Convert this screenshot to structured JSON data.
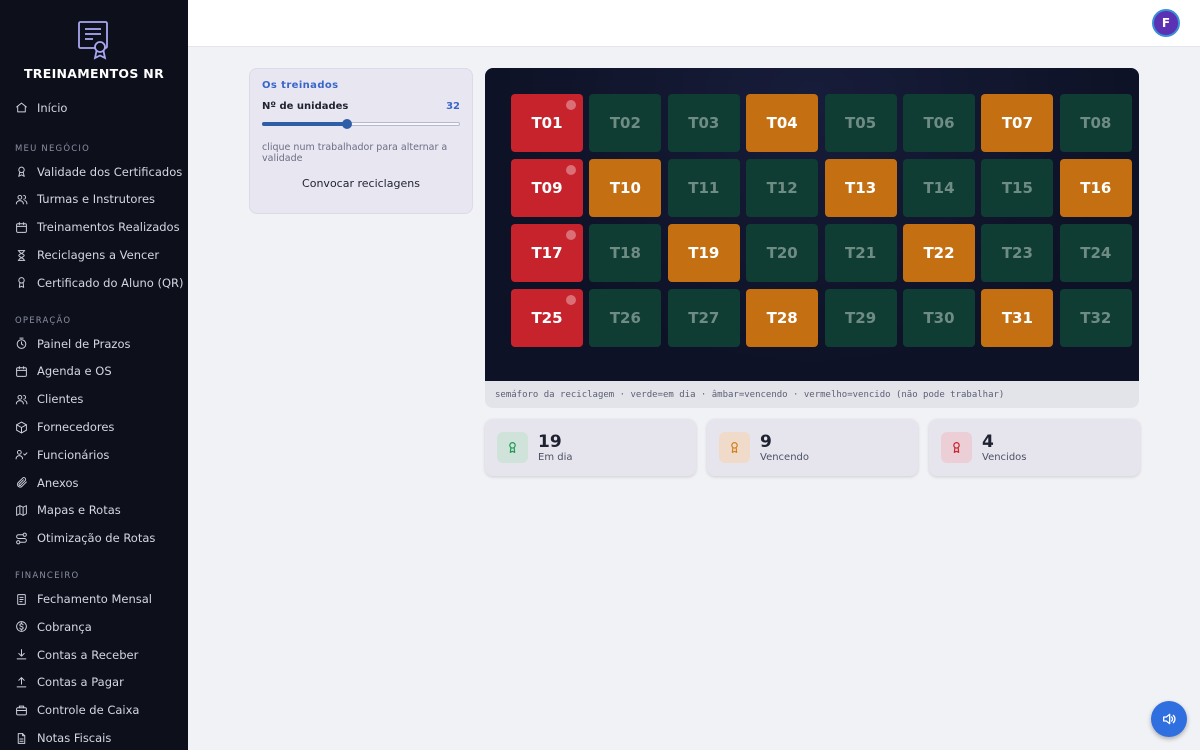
{
  "app": {
    "title": "TREINAMENTOS NR"
  },
  "user": {
    "initial": "F"
  },
  "sidebar": {
    "home": "Início",
    "sections": [
      {
        "title": "MEU NEGÓCIO",
        "items": [
          {
            "label": "Validade dos Certificados",
            "icon": "certificate-icon"
          },
          {
            "label": "Turmas e Instrutores",
            "icon": "users-icon"
          },
          {
            "label": "Treinamentos Realizados",
            "icon": "calendar-icon"
          },
          {
            "label": "Reciclagens a Vencer",
            "icon": "hourglass-icon"
          },
          {
            "label": "Certificado do Aluno (QR)",
            "icon": "award-icon"
          }
        ]
      },
      {
        "title": "OPERAÇÃO",
        "items": [
          {
            "label": "Painel de Prazos",
            "icon": "clock-icon"
          },
          {
            "label": "Agenda e OS",
            "icon": "calendar-icon"
          },
          {
            "label": "Clientes",
            "icon": "users-icon"
          },
          {
            "label": "Fornecedores",
            "icon": "box-icon"
          },
          {
            "label": "Funcionários",
            "icon": "user-group-icon"
          },
          {
            "label": "Anexos",
            "icon": "paperclip-icon"
          },
          {
            "label": "Mapas e Rotas",
            "icon": "map-icon"
          },
          {
            "label": "Otimização de Rotas",
            "icon": "route-icon"
          }
        ]
      },
      {
        "title": "FINANCEIRO",
        "items": [
          {
            "label": "Fechamento Mensal",
            "icon": "receipt-icon"
          },
          {
            "label": "Cobrança",
            "icon": "dollar-icon"
          },
          {
            "label": "Contas a Receber",
            "icon": "download-icon"
          },
          {
            "label": "Contas a Pagar",
            "icon": "upload-icon"
          },
          {
            "label": "Controle de Caixa",
            "icon": "cashbox-icon"
          },
          {
            "label": "Notas Fiscais",
            "icon": "file-icon"
          }
        ]
      }
    ]
  },
  "control": {
    "heading": "Os treinados",
    "units_label": "Nº de unidades",
    "units_value": "32",
    "slider_fraction": 0.43,
    "hint": "clique num trabalhador para alternar a validade",
    "button": "Convocar reciclagens"
  },
  "grid": {
    "columns": 8,
    "tiles": [
      {
        "label": "T01",
        "status": "late"
      },
      {
        "label": "T02",
        "status": "ok"
      },
      {
        "label": "T03",
        "status": "ok"
      },
      {
        "label": "T04",
        "status": "warn"
      },
      {
        "label": "T05",
        "status": "ok"
      },
      {
        "label": "T06",
        "status": "ok"
      },
      {
        "label": "T07",
        "status": "warn"
      },
      {
        "label": "T08",
        "status": "ok"
      },
      {
        "label": "T09",
        "status": "late"
      },
      {
        "label": "T10",
        "status": "warn"
      },
      {
        "label": "T11",
        "status": "ok"
      },
      {
        "label": "T12",
        "status": "ok"
      },
      {
        "label": "T13",
        "status": "warn"
      },
      {
        "label": "T14",
        "status": "ok"
      },
      {
        "label": "T15",
        "status": "ok"
      },
      {
        "label": "T16",
        "status": "warn"
      },
      {
        "label": "T17",
        "status": "late"
      },
      {
        "label": "T18",
        "status": "ok"
      },
      {
        "label": "T19",
        "status": "warn"
      },
      {
        "label": "T20",
        "status": "ok"
      },
      {
        "label": "T21",
        "status": "ok"
      },
      {
        "label": "T22",
        "status": "warn"
      },
      {
        "label": "T23",
        "status": "ok"
      },
      {
        "label": "T24",
        "status": "ok"
      },
      {
        "label": "T25",
        "status": "late"
      },
      {
        "label": "T26",
        "status": "ok"
      },
      {
        "label": "T27",
        "status": "ok"
      },
      {
        "label": "T28",
        "status": "warn"
      },
      {
        "label": "T29",
        "status": "ok"
      },
      {
        "label": "T30",
        "status": "ok"
      },
      {
        "label": "T31",
        "status": "warn"
      },
      {
        "label": "T32",
        "status": "ok"
      }
    ],
    "legend": "semáforo da reciclagem · verde=em dia · âmbar=vencendo · vermelho=vencido (não pode trabalhar)"
  },
  "stats": [
    {
      "value": "19",
      "label": "Em dia",
      "color": "#1f9a52",
      "bg": "#cfe3da"
    },
    {
      "value": "9",
      "label": "Vencendo",
      "color": "#d0801a",
      "bg": "#f0dbcb"
    },
    {
      "value": "4",
      "label": "Vencidos",
      "color": "#c6232c",
      "bg": "#eccfd6"
    }
  ],
  "colors": {
    "accent": "#3b66c9",
    "ok": "#0f3d33",
    "warn": "#c47012",
    "late": "#c6232c",
    "fab": "#2f6fe0"
  },
  "fab": {
    "icon": "speaker-icon"
  }
}
